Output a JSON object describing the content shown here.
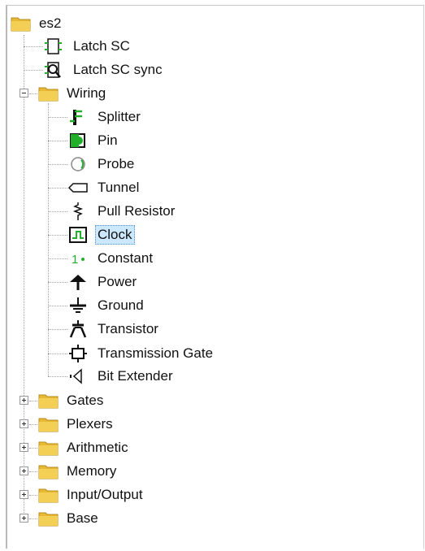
{
  "tree": {
    "root": {
      "label": "es2",
      "icon": "folder-icon"
    },
    "root_children": [
      {
        "label": "Latch SC",
        "icon": "subcircuit-icon"
      },
      {
        "label": "Latch SC sync",
        "icon": "subcircuit-magnify-icon"
      }
    ],
    "wiring": {
      "label": "Wiring",
      "expanded": true,
      "items": [
        {
          "label": "Splitter",
          "icon": "splitter-icon"
        },
        {
          "label": "Pin",
          "icon": "pin-icon"
        },
        {
          "label": "Probe",
          "icon": "probe-icon"
        },
        {
          "label": "Tunnel",
          "icon": "tunnel-icon"
        },
        {
          "label": "Pull Resistor",
          "icon": "pull-resistor-icon"
        },
        {
          "label": "Clock",
          "icon": "clock-icon",
          "selected": true
        },
        {
          "label": "Constant",
          "icon": "constant-icon"
        },
        {
          "label": "Power",
          "icon": "power-icon"
        },
        {
          "label": "Ground",
          "icon": "ground-icon"
        },
        {
          "label": "Transistor",
          "icon": "transistor-icon"
        },
        {
          "label": "Transmission Gate",
          "icon": "transmission-gate-icon"
        },
        {
          "label": "Bit Extender",
          "icon": "bit-extender-icon"
        }
      ]
    },
    "collapsed_folders": [
      {
        "label": "Gates"
      },
      {
        "label": "Plexers"
      },
      {
        "label": "Arithmetic"
      },
      {
        "label": "Memory"
      },
      {
        "label": "Input/Output"
      },
      {
        "label": "Base"
      }
    ]
  },
  "colors": {
    "folder": "#e8b935",
    "accent_green": "#22b02b",
    "selection": "#cce8ff"
  }
}
